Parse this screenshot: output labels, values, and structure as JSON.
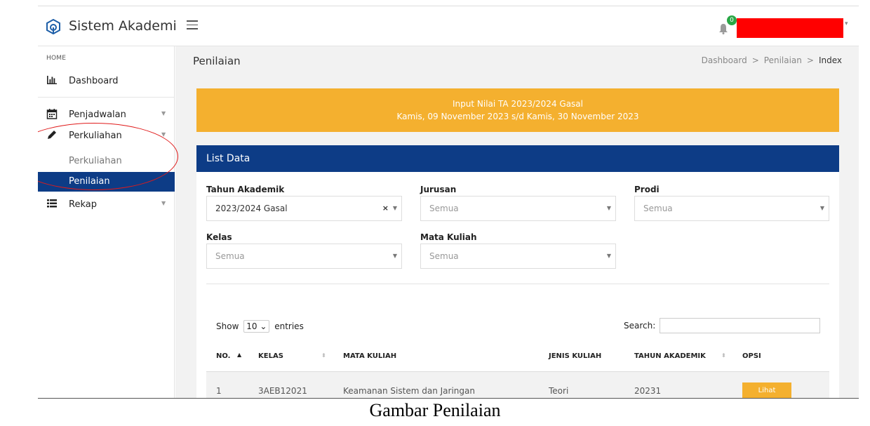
{
  "app": {
    "title": "Sistem Akademik",
    "notification_count": "0"
  },
  "sidebar": {
    "header": "HOME",
    "items": [
      {
        "label": "Dashboard",
        "icon": "bar-chart-icon"
      },
      {
        "label": "Penjadwalan",
        "icon": "calendar-icon"
      },
      {
        "label": "Perkuliahan",
        "icon": "pencil-icon"
      },
      {
        "label": "Rekap",
        "icon": "list-icon"
      }
    ],
    "subitems": [
      {
        "label": "Perkuliahan"
      },
      {
        "label": "Penilaian",
        "active": true
      }
    ]
  },
  "page": {
    "title": "Penilaian",
    "breadcrumb": [
      "Dashboard",
      "Penilaian",
      "Index"
    ],
    "breadcrumb_sep": ">"
  },
  "alert": {
    "line1": "Input Nilai TA 2023/2024 Gasal",
    "line2": "Kamis, 09 November 2023 s/d Kamis, 30 November 2023"
  },
  "card": {
    "title": "List Data",
    "filters": {
      "tahun_akademik": {
        "label": "Tahun Akademik",
        "value": "2023/2024 Gasal"
      },
      "jurusan": {
        "label": "Jurusan",
        "value": "Semua"
      },
      "prodi": {
        "label": "Prodi",
        "value": "Semua"
      },
      "kelas": {
        "label": "Kelas",
        "value": "Semua"
      },
      "mata_kuliah": {
        "label": "Mata Kuliah",
        "value": "Semua"
      }
    },
    "table_controls": {
      "show_label": "Show",
      "entries_value": "10",
      "entries_label": "entries",
      "search_label": "Search:",
      "search_value": ""
    },
    "table": {
      "headers": [
        "NO.",
        "KELAS",
        "MATA KULIAH",
        "JENIS KULIAH",
        "TAHUN AKADEMIK",
        "OPSI"
      ],
      "rows": [
        {
          "no": "1",
          "kelas": "3AEB12021",
          "mata_kuliah": "Keamanan Sistem dan Jaringan",
          "jenis": "Teori",
          "tahun": "20231",
          "opsi": "Lihat"
        }
      ]
    }
  },
  "caption": "Gambar Penilaian",
  "colors": {
    "primary": "#0d3c86",
    "warning": "#f4b02f",
    "badge": "#28a745",
    "annotation": "#e01b1b",
    "redaction": "#ff0000"
  }
}
